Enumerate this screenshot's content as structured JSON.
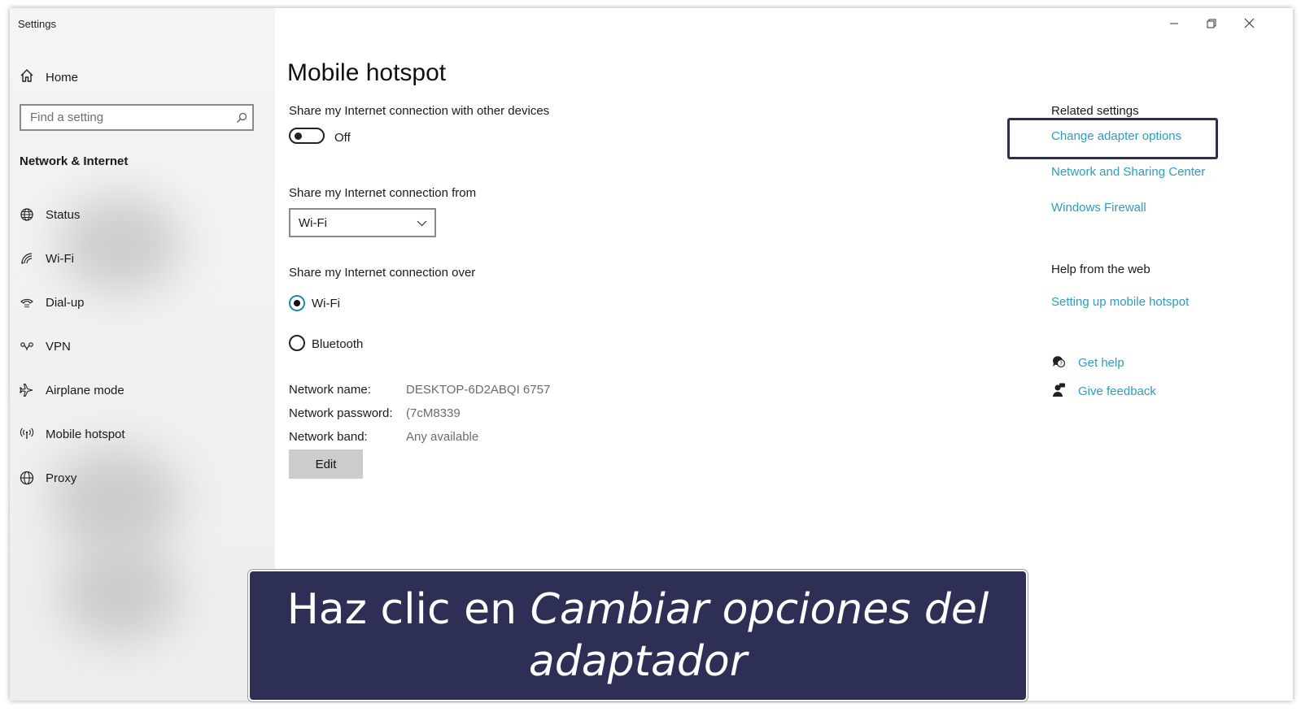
{
  "window": {
    "title": "Settings",
    "controls": [
      "minimize",
      "restore",
      "close"
    ]
  },
  "sidebar": {
    "home_label": "Home",
    "search_placeholder": "Find a setting",
    "section_title": "Network & Internet",
    "items": [
      {
        "label": "Status",
        "icon": "globe-status-icon"
      },
      {
        "label": "Wi-Fi",
        "icon": "wifi-icon"
      },
      {
        "label": "Dial-up",
        "icon": "dialup-icon"
      },
      {
        "label": "VPN",
        "icon": "vpn-icon"
      },
      {
        "label": "Airplane mode",
        "icon": "airplane-icon"
      },
      {
        "label": "Mobile hotspot",
        "icon": "hotspot-icon"
      },
      {
        "label": "Proxy",
        "icon": "globe-icon"
      }
    ]
  },
  "main": {
    "title": "Mobile hotspot",
    "share_label": "Share my Internet connection with other devices",
    "toggle_state": "Off",
    "from_label": "Share my Internet connection from",
    "from_value": "Wi-Fi",
    "over_label": "Share my Internet connection over",
    "over_options": [
      {
        "label": "Wi-Fi",
        "checked": true
      },
      {
        "label": "Bluetooth",
        "checked": false
      }
    ],
    "network_name_label": "Network name:",
    "network_name_value": "DESKTOP-6D2ABQI 6757",
    "network_password_label": "Network password:",
    "network_password_value": "(7cM8339",
    "network_band_label": "Network band:",
    "network_band_value": "Any available",
    "edit_label": "Edit"
  },
  "related": {
    "heading": "Related settings",
    "links": [
      "Change adapter options",
      "Network and Sharing Center",
      "Windows Firewall"
    ],
    "help_heading": "Help from the web",
    "help_link": "Setting up mobile hotspot",
    "get_help": "Get help",
    "give_feedback": "Give feedback"
  },
  "caption": {
    "prefix": "Haz clic en ",
    "emphasis": "Cambiar opciones del adaptador"
  },
  "colors": {
    "link": "#2c9dc1",
    "caption_bg": "#2d2f55",
    "highlight_border": "#2c2e52"
  }
}
